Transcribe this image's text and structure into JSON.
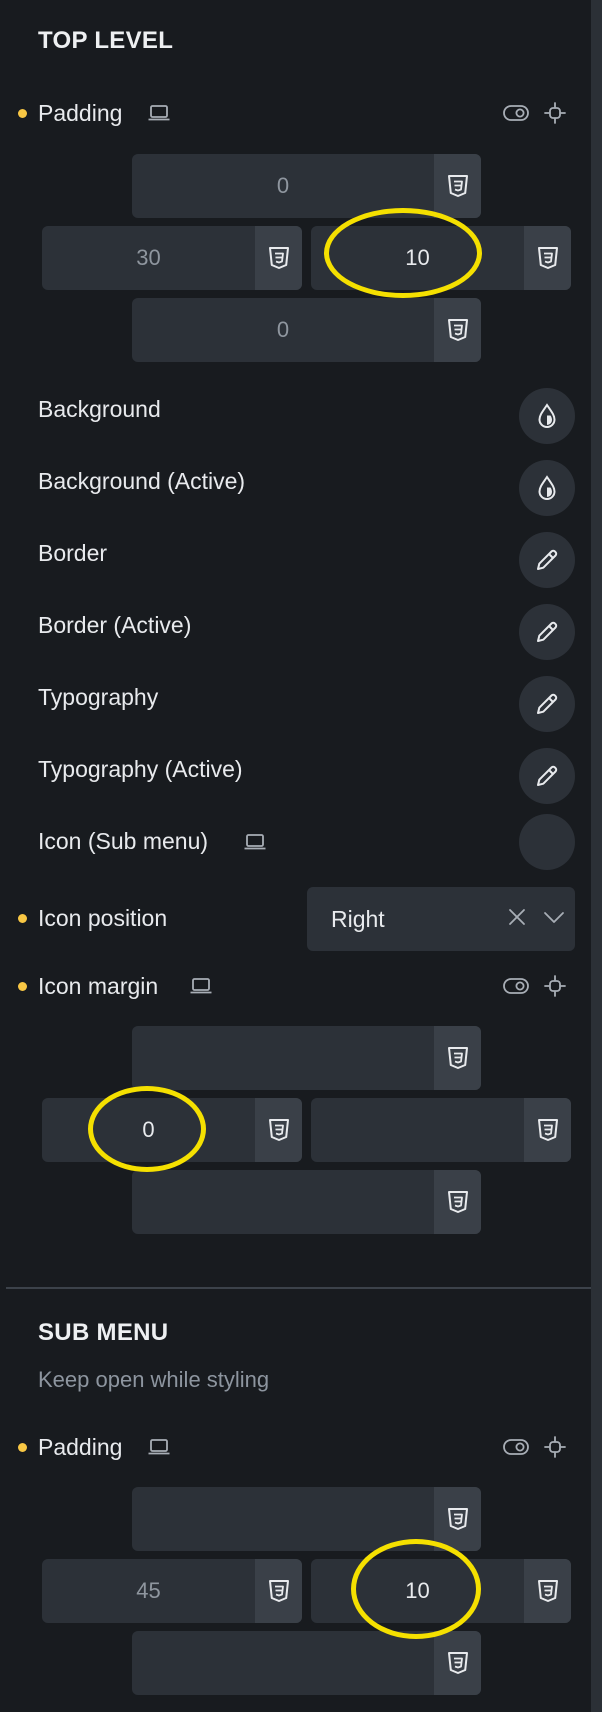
{
  "top_level": {
    "title": "TOP LEVEL",
    "padding": {
      "label": "Padding",
      "top": "0",
      "left": "30",
      "right": "10",
      "bottom": "0"
    },
    "rows": [
      {
        "label": "Background",
        "icon": "droplet-icon"
      },
      {
        "label": "Background (Active)",
        "icon": "droplet-icon"
      },
      {
        "label": "Border",
        "icon": "pencil-icon"
      },
      {
        "label": "Border (Active)",
        "icon": "pencil-icon"
      },
      {
        "label": "Typography",
        "icon": "pencil-icon"
      },
      {
        "label": "Typography (Active)",
        "icon": "pencil-icon"
      },
      {
        "label": "Icon (Sub menu)",
        "icon": "empty"
      }
    ],
    "icon_position": {
      "label": "Icon position",
      "value": "Right"
    },
    "icon_margin": {
      "label": "Icon margin",
      "top": "",
      "left": "0",
      "right": "",
      "bottom": ""
    }
  },
  "sub_menu": {
    "title": "SUB MENU",
    "note": "Keep open while styling",
    "padding": {
      "label": "Padding",
      "top": "",
      "left": "45",
      "right": "10",
      "bottom": ""
    }
  },
  "colors": {
    "background": "#181b1f",
    "field": "#2c3138",
    "css_tag": "#3a4048",
    "accent_dot": "#f8c744",
    "highlight": "#f5e000"
  }
}
